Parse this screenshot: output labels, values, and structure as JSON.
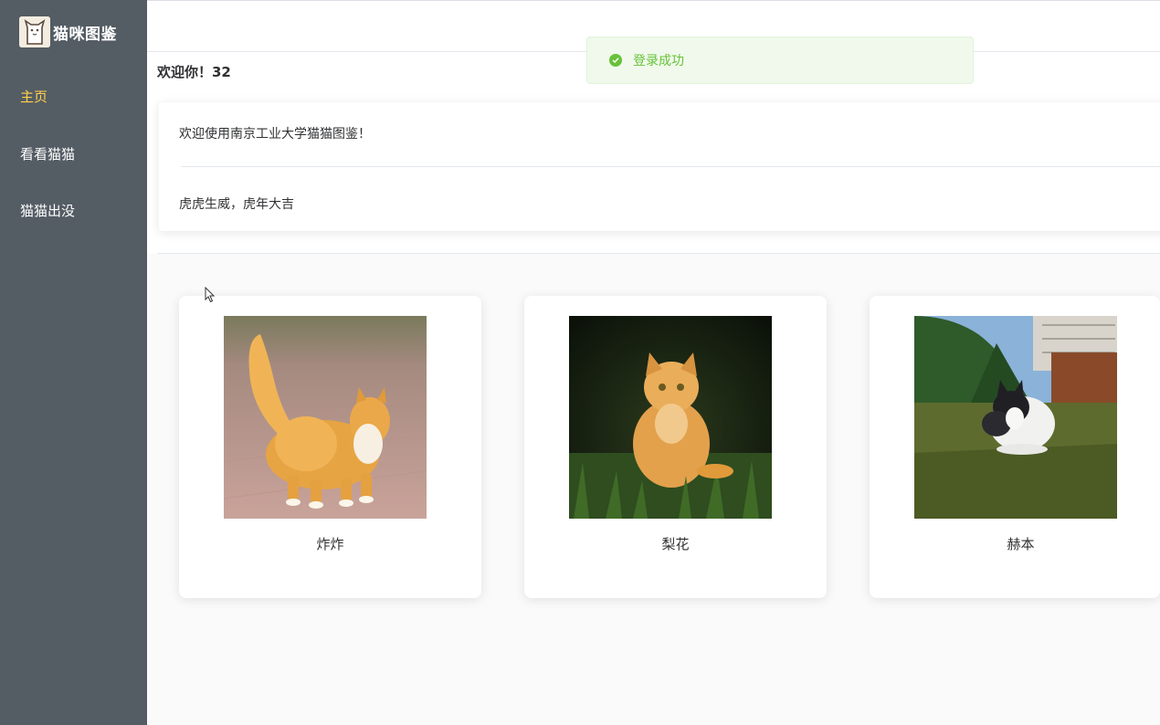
{
  "app": {
    "title": "猫咪图鉴",
    "logo_icon": "cat-logo-icon"
  },
  "sidebar": {
    "bg_color": "#545c64",
    "active_color": "#ffd04b",
    "items": [
      {
        "label": "主页",
        "active": true
      },
      {
        "label": "看看猫猫",
        "active": false
      },
      {
        "label": "猫猫出没",
        "active": false
      }
    ]
  },
  "toast": {
    "icon": "success-check-icon",
    "message": "登录成功",
    "color": "#67c23a"
  },
  "main": {
    "welcome_user": "欢迎你！32",
    "info": {
      "line1": "欢迎使用南京工业大学猫猫图鉴！",
      "line2": "虎虎生威，虎年大吉"
    }
  },
  "cats": [
    {
      "name": "炸炸"
    },
    {
      "name": "梨花"
    },
    {
      "name": "赫本"
    }
  ]
}
